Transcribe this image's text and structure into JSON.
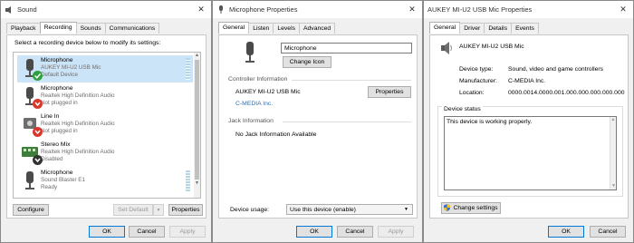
{
  "sound": {
    "title": "Sound",
    "close": "✕",
    "tabs": [
      "Playback",
      "Recording",
      "Sounds",
      "Communications"
    ],
    "instruction": "Select a recording device below to modify its settings:",
    "devices": [
      {
        "name": "Microphone",
        "line1": "AUKEY MI-U2 USB Mic",
        "line2": "Default Device"
      },
      {
        "name": "Microphone",
        "line1": "Realtek High Definition Audio",
        "line2": "Not plugged in"
      },
      {
        "name": "Line In",
        "line1": "Realtek High Definition Audio",
        "line2": "Not plugged in"
      },
      {
        "name": "Stereo Mix",
        "line1": "Realtek High Definition Audio",
        "line2": "Disabled"
      },
      {
        "name": "Microphone",
        "line1": "Sound Blaster E1",
        "line2": "Ready"
      }
    ],
    "configure": "Configure",
    "set_default": "Set Default",
    "properties": "Properties",
    "ok": "OK",
    "cancel": "Cancel",
    "apply": "Apply",
    "colors": {
      "selected": "#cce4f7",
      "check": "#2e9e3e",
      "unplugged": "#d9372b"
    }
  },
  "mic": {
    "title": "Microphone Properties",
    "close": "✕",
    "tabs": [
      "General",
      "Listen",
      "Levels",
      "Advanced"
    ],
    "name_value": "Microphone",
    "change_icon": "Change Icon",
    "controller_header": "Controller Information",
    "controller_name": "AUKEY MI-U2 USB Mic",
    "controller_props": "Properties",
    "controller_vendor": "C-MEDIA Inc.",
    "jack_header": "Jack Information",
    "jack_value": "No Jack Information Available",
    "usage_label": "Device usage:",
    "usage_value": "Use this device (enable)",
    "ok": "OK",
    "cancel": "Cancel",
    "apply": "Apply"
  },
  "aukey": {
    "title": "AUKEY MI-U2 USB Mic Properties",
    "close": "✕",
    "tabs": [
      "General",
      "Driver",
      "Details",
      "Events"
    ],
    "device_name": "AUKEY MI-U2 USB Mic",
    "type_label": "Device type:",
    "type_value": "Sound, video and game controllers",
    "mfr_label": "Manufacturer:",
    "mfr_value": "C-MEDIA Inc.",
    "loc_label": "Location:",
    "loc_value": "0000.0014.0000.001.000.000.000.000.000",
    "status_header": "Device status",
    "status_text": "This device is working properly.",
    "change_settings": "Change settings",
    "ok": "OK",
    "cancel": "Cancel"
  }
}
